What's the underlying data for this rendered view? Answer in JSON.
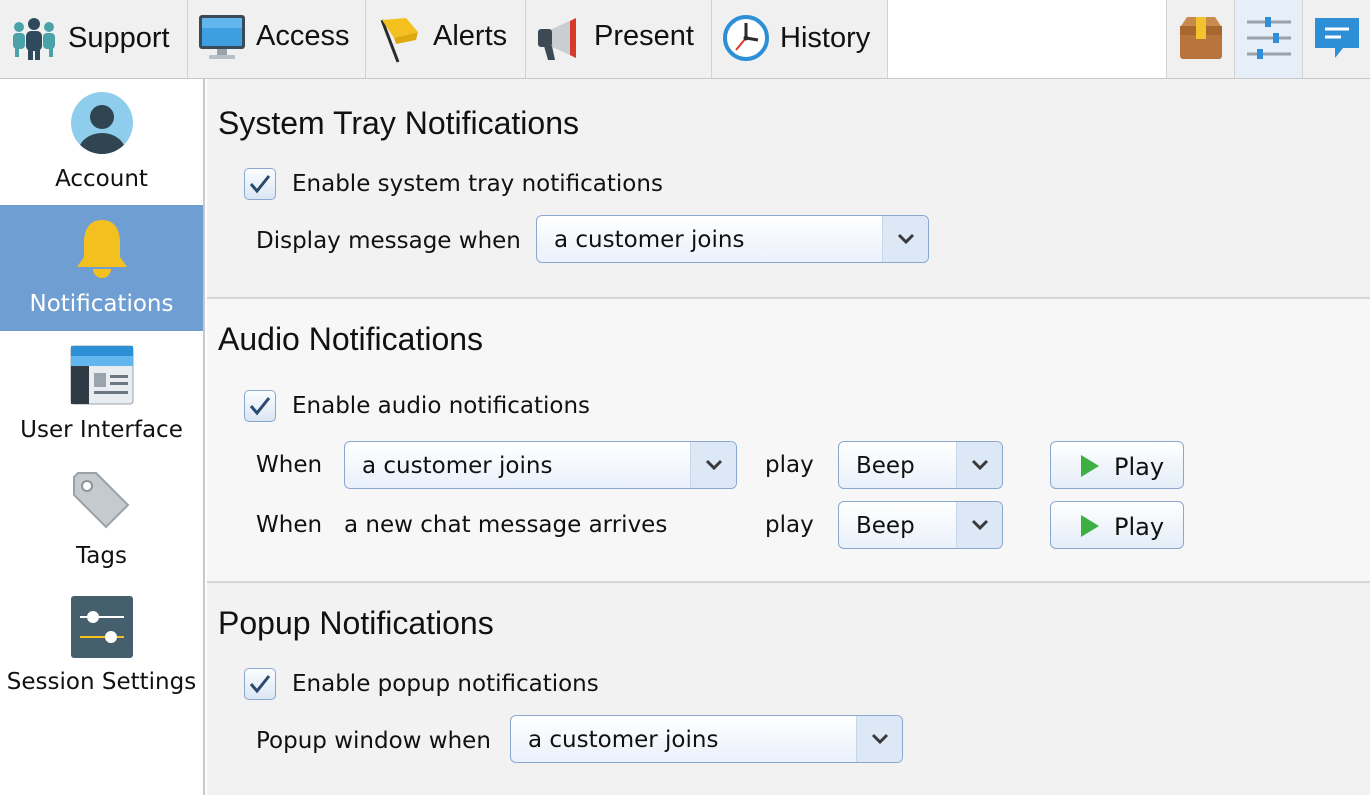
{
  "toolbar": {
    "tabs": [
      {
        "label": "Support",
        "icon": "people-icon"
      },
      {
        "label": "Access",
        "icon": "monitor-icon"
      },
      {
        "label": "Alerts",
        "icon": "flag-icon"
      },
      {
        "label": "Present",
        "icon": "megaphone-icon"
      },
      {
        "label": "History",
        "icon": "clock-icon"
      }
    ],
    "tools": [
      {
        "icon": "package-icon",
        "active": false
      },
      {
        "icon": "settings-sliders-icon",
        "active": true
      },
      {
        "icon": "chat-message-icon",
        "active": false
      }
    ]
  },
  "sidebar": {
    "items": [
      {
        "label": "Account",
        "icon": "user-avatar-icon",
        "active": false
      },
      {
        "label": "Notifications",
        "icon": "bell-icon",
        "active": true
      },
      {
        "label": "User Interface",
        "icon": "window-layout-icon",
        "active": false
      },
      {
        "label": "Tags",
        "icon": "tag-icon",
        "active": false
      },
      {
        "label": "Session Settings",
        "icon": "sliders-icon",
        "active": false
      }
    ]
  },
  "system_tray": {
    "title": "System Tray Notifications",
    "enable_label": "Enable system tray notifications",
    "enabled": true,
    "display_label": "Display message when",
    "display_value": "a customer joins"
  },
  "audio": {
    "title": "Audio Notifications",
    "enable_label": "Enable audio notifications",
    "enabled": true,
    "rows": [
      {
        "when_label": "When",
        "event": "a customer joins",
        "event_is_select": true,
        "play_label": "play",
        "sound": "Beep",
        "button_label": "Play"
      },
      {
        "when_label": "When",
        "event": "a new chat message arrives",
        "event_is_select": false,
        "play_label": "play",
        "sound": "Beep",
        "button_label": "Play"
      }
    ]
  },
  "popup": {
    "title": "Popup Notifications",
    "enable_label": "Enable popup notifications",
    "enabled": true,
    "window_label": "Popup window when",
    "window_value": "a customer joins"
  },
  "colors": {
    "sidebar_active": "#6f9fd2",
    "accent_blue": "#2d8fd6",
    "play_green": "#3cb043"
  }
}
